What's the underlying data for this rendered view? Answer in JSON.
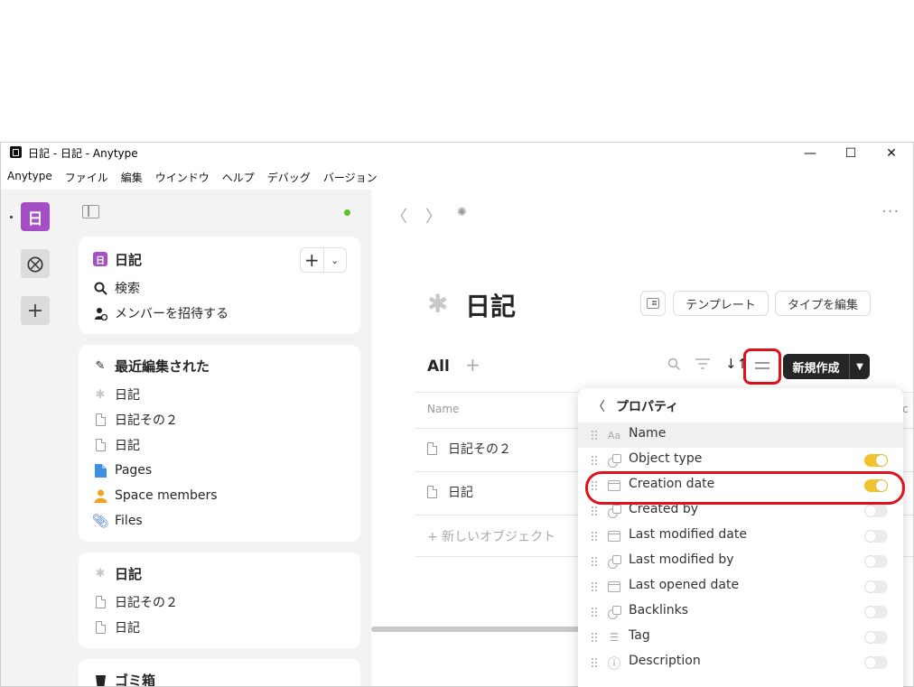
{
  "window": {
    "title": "日記 - 日記 - Anytype",
    "controls": {
      "minimize": "—",
      "maximize": "☐",
      "close": "✕"
    }
  },
  "menubar": [
    "Anytype",
    "ファイル",
    "編集",
    "ウインドウ",
    "ヘルプ",
    "デバッグ",
    "バージョン"
  ],
  "rail": {
    "space_letter": "日",
    "second_space_icon": "no-entry-icon",
    "add_label": "+"
  },
  "sidebar": {
    "widget_space": {
      "badge": "日",
      "title": "日記",
      "add": "+",
      "chevron": "⌄",
      "search": "検索",
      "invite": "メンバーを招待する"
    },
    "recent": {
      "title": "最近編集された",
      "items": [
        {
          "label": "日記",
          "icon": "puzzle-icon"
        },
        {
          "label": "日記その２",
          "icon": "page-icon"
        },
        {
          "label": "日記",
          "icon": "page-icon"
        },
        {
          "label": "Pages",
          "icon": "pages-icon",
          "color": "#3d8fe0"
        },
        {
          "label": "Space members",
          "icon": "person-icon",
          "color": "#f2a21c"
        },
        {
          "label": "Files",
          "icon": "paperclip-icon",
          "color": "#4a7bd8"
        }
      ]
    },
    "type_widget": {
      "title": "日記",
      "items": [
        "日記その２",
        "日記"
      ]
    },
    "bin": {
      "title": "ゴミ箱"
    }
  },
  "main": {
    "page_title": "日記",
    "template_btn": "テンプレート",
    "edit_type_btn": "タイプを編集",
    "view_tab": "All",
    "view_add": "+",
    "create_btn": "新規作成",
    "column_name": "Name",
    "column_cut": "c",
    "rows": [
      "日記その２",
      "日記"
    ],
    "new_object": "+ 新しいオブジェクト"
  },
  "properties_menu": {
    "title": "プロパティ",
    "items": [
      {
        "label": "Name",
        "icon": "text-icon",
        "glyph": "Aa",
        "toggle": null
      },
      {
        "label": "Object type",
        "icon": "object-icon",
        "toggle": true
      },
      {
        "label": "Creation date",
        "icon": "calendar-icon",
        "toggle": true
      },
      {
        "label": "Created by",
        "icon": "object-icon",
        "toggle": false
      },
      {
        "label": "Last modified date",
        "icon": "calendar-icon",
        "toggle": false
      },
      {
        "label": "Last modified by",
        "icon": "object-icon",
        "toggle": false
      },
      {
        "label": "Last opened date",
        "icon": "calendar-icon",
        "toggle": false
      },
      {
        "label": "Backlinks",
        "icon": "object-icon",
        "toggle": false
      },
      {
        "label": "Tag",
        "icon": "tag-icon",
        "toggle": false
      },
      {
        "label": "Description",
        "icon": "info-icon",
        "toggle": false
      }
    ]
  },
  "colors": {
    "accent_space": "#a54fc4",
    "toggle_on": "#f2c231",
    "highlight": "#e0101c",
    "online": "#5bc12a"
  }
}
